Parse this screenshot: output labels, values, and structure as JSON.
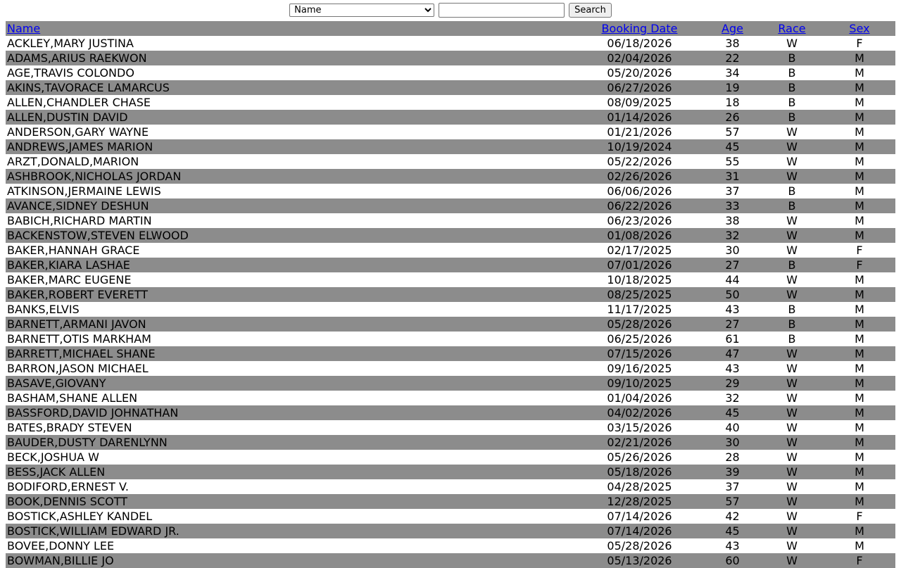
{
  "search": {
    "field_selected": "Name",
    "input_value": "",
    "button_label": "Search"
  },
  "columns": {
    "name": "Name",
    "booking_date": "Booking Date",
    "age": "Age",
    "race": "Race",
    "sex": "Sex"
  },
  "rows": [
    {
      "name": "ACKLEY,MARY JUSTINA",
      "date": "06/18/2026",
      "age": "38",
      "race": "W",
      "sex": "F"
    },
    {
      "name": "ADAMS,ARIUS RAEKWON",
      "date": "02/04/2026",
      "age": "22",
      "race": "B",
      "sex": "M"
    },
    {
      "name": "AGE,TRAVIS COLONDO",
      "date": "05/20/2026",
      "age": "34",
      "race": "B",
      "sex": "M"
    },
    {
      "name": "AKINS,TAVORACE LAMARCUS",
      "date": "06/27/2026",
      "age": "19",
      "race": "B",
      "sex": "M"
    },
    {
      "name": "ALLEN,CHANDLER CHASE",
      "date": "08/09/2025",
      "age": "18",
      "race": "B",
      "sex": "M"
    },
    {
      "name": "ALLEN,DUSTIN DAVID",
      "date": "01/14/2026",
      "age": "26",
      "race": "B",
      "sex": "M"
    },
    {
      "name": "ANDERSON,GARY WAYNE",
      "date": "01/21/2026",
      "age": "57",
      "race": "W",
      "sex": "M"
    },
    {
      "name": "ANDREWS,JAMES MARION",
      "date": "10/19/2024",
      "age": "45",
      "race": "W",
      "sex": "M"
    },
    {
      "name": "ARZT,DONALD,MARION",
      "date": "05/22/2026",
      "age": "55",
      "race": "W",
      "sex": "M"
    },
    {
      "name": "ASHBROOK,NICHOLAS JORDAN",
      "date": "02/26/2026",
      "age": "31",
      "race": "W",
      "sex": "M"
    },
    {
      "name": "ATKINSON,JERMAINE LEWIS",
      "date": "06/06/2026",
      "age": "37",
      "race": "B",
      "sex": "M"
    },
    {
      "name": "AVANCE,SIDNEY DESHUN",
      "date": "06/22/2026",
      "age": "33",
      "race": "B",
      "sex": "M"
    },
    {
      "name": "BABICH,RICHARD MARTIN",
      "date": "06/23/2026",
      "age": "38",
      "race": "W",
      "sex": "M"
    },
    {
      "name": "BACKENSTOW,STEVEN ELWOOD",
      "date": "01/08/2026",
      "age": "32",
      "race": "W",
      "sex": "M"
    },
    {
      "name": "BAKER,HANNAH GRACE",
      "date": "02/17/2025",
      "age": "30",
      "race": "W",
      "sex": "F"
    },
    {
      "name": "BAKER,KIARA LASHAE",
      "date": "07/01/2026",
      "age": "27",
      "race": "B",
      "sex": "F"
    },
    {
      "name": "BAKER,MARC EUGENE",
      "date": "10/18/2025",
      "age": "44",
      "race": "W",
      "sex": "M"
    },
    {
      "name": "BAKER,ROBERT EVERETT",
      "date": "08/25/2025",
      "age": "50",
      "race": "W",
      "sex": "M"
    },
    {
      "name": "BANKS,ELVIS",
      "date": "11/17/2025",
      "age": "43",
      "race": "B",
      "sex": "M"
    },
    {
      "name": "BARNETT,ARMANI JAVON",
      "date": "05/28/2026",
      "age": "27",
      "race": "B",
      "sex": "M"
    },
    {
      "name": "BARNETT,OTIS MARKHAM",
      "date": "06/25/2026",
      "age": "61",
      "race": "B",
      "sex": "M"
    },
    {
      "name": "BARRETT,MICHAEL SHANE",
      "date": "07/15/2026",
      "age": "47",
      "race": "W",
      "sex": "M"
    },
    {
      "name": "BARRON,JASON MICHAEL",
      "date": "09/16/2025",
      "age": "43",
      "race": "W",
      "sex": "M"
    },
    {
      "name": "BASAVE,GIOVANY",
      "date": "09/10/2025",
      "age": "29",
      "race": "W",
      "sex": "M"
    },
    {
      "name": "BASHAM,SHANE ALLEN",
      "date": "01/04/2026",
      "age": "32",
      "race": "W",
      "sex": "M"
    },
    {
      "name": "BASSFORD,DAVID JOHNATHAN",
      "date": "04/02/2026",
      "age": "45",
      "race": "W",
      "sex": "M"
    },
    {
      "name": "BATES,BRADY STEVEN",
      "date": "03/15/2026",
      "age": "40",
      "race": "W",
      "sex": "M"
    },
    {
      "name": "BAUDER,DUSTY DARENLYNN",
      "date": "02/21/2026",
      "age": "30",
      "race": "W",
      "sex": "M"
    },
    {
      "name": "BECK,JOSHUA W",
      "date": "05/26/2026",
      "age": "28",
      "race": "W",
      "sex": "M"
    },
    {
      "name": "BESS,JACK ALLEN",
      "date": "05/18/2026",
      "age": "39",
      "race": "W",
      "sex": "M"
    },
    {
      "name": "BODIFORD,ERNEST V.",
      "date": "04/28/2025",
      "age": "37",
      "race": "W",
      "sex": "M"
    },
    {
      "name": "BOOK,DENNIS SCOTT",
      "date": "12/28/2025",
      "age": "57",
      "race": "W",
      "sex": "M"
    },
    {
      "name": "BOSTICK,ASHLEY KANDEL",
      "date": "07/14/2026",
      "age": "42",
      "race": "W",
      "sex": "F"
    },
    {
      "name": "BOSTICK,WILLIAM EDWARD JR.",
      "date": "07/14/2026",
      "age": "45",
      "race": "W",
      "sex": "M"
    },
    {
      "name": "BOVEE,DONNY LEE",
      "date": "05/28/2026",
      "age": "43",
      "race": "W",
      "sex": "M"
    },
    {
      "name": "BOWMAN,BILLIE JO",
      "date": "05/13/2026",
      "age": "60",
      "race": "W",
      "sex": "F"
    }
  ]
}
